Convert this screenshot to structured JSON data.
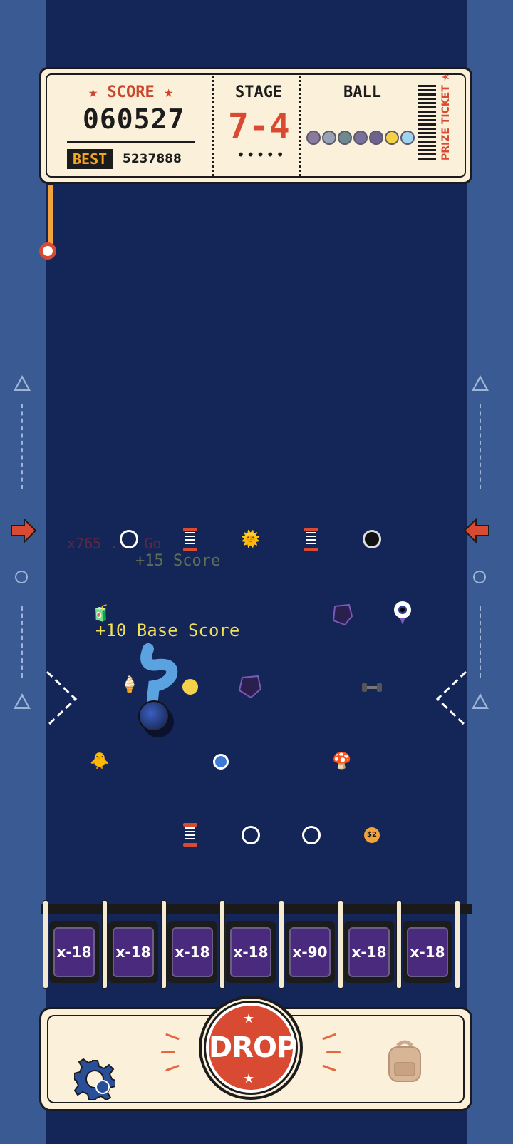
{
  "header": {
    "score_label": "★ SCORE ★",
    "score_value": "060527",
    "best_label": "BEST",
    "best_value": "5237888",
    "stage_label": "STAGE",
    "stage_value": "7-4",
    "stage_dots": "•••••",
    "ball_label": "BALL",
    "ticket_label": "PRIZE TICKET ★"
  },
  "board": {
    "floating_texts": {
      "faded": "x765 ... Go",
      "plus_score": "+15 Score",
      "base_score": "+10 Base Score"
    },
    "coin_label": "$2"
  },
  "buckets": [
    {
      "label": "x-18"
    },
    {
      "label": "x-18"
    },
    {
      "label": "x-18"
    },
    {
      "label": "x-18"
    },
    {
      "label": "x-90"
    },
    {
      "label": "x-18"
    },
    {
      "label": "x-18"
    }
  ],
  "controls": {
    "drop_label": "DROP"
  },
  "colors": {
    "board": "#142657",
    "accent_red": "#d94a32",
    "bucket": "#4a2a7d",
    "ticket": "#fbf0da"
  }
}
